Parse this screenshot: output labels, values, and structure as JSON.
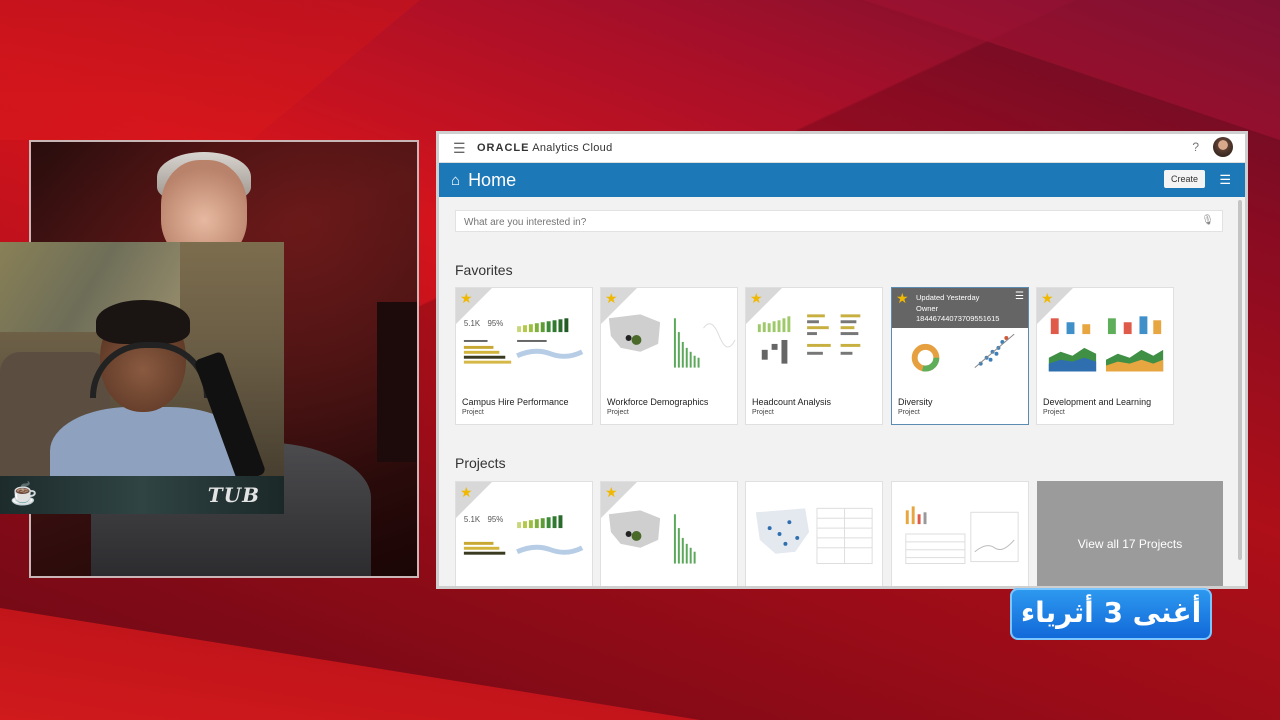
{
  "topbar": {
    "brand_bold": "ORACLE",
    "brand_rest": "Analytics Cloud",
    "help": "?"
  },
  "homebar": {
    "title": "Home",
    "create_label": "Create"
  },
  "search": {
    "placeholder": "What are you interested in?"
  },
  "favorites": {
    "title": "Favorites",
    "cards": [
      {
        "name": "Campus Hire Performance",
        "type": "Project",
        "kpi1": "5.1K",
        "kpi2": "95%"
      },
      {
        "name": "Workforce Demographics",
        "type": "Project"
      },
      {
        "name": "Headcount Analysis",
        "type": "Project"
      },
      {
        "name": "Diversity",
        "type": "Project",
        "overlay": [
          "Updated Yesterday",
          "Owner",
          "18446744073709551615"
        ]
      },
      {
        "name": "Development and Learning",
        "type": "Project"
      }
    ]
  },
  "projects": {
    "title": "Projects",
    "kpi1": "5.1K",
    "kpi2": "95%",
    "view_all": "View all 17 Projects"
  },
  "webcam": {
    "tag": "TUB"
  },
  "caption": {
    "text": "أغنى 3 أثرياء"
  },
  "colors": {
    "accent": "#1d78b8",
    "star": "#f0b800",
    "caption_bg": "#1167d8"
  }
}
